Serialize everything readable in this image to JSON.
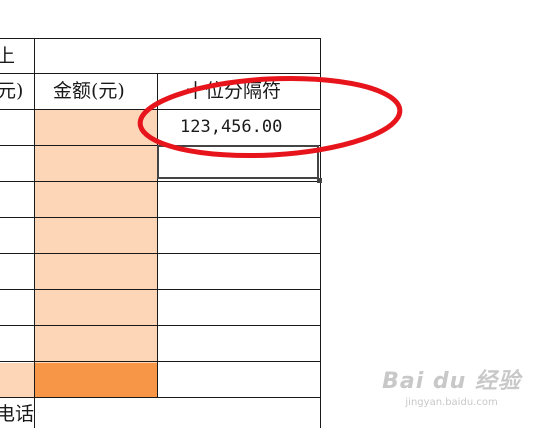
{
  "sheet": {
    "header_row_label": "上",
    "col_a_header_partial": "元)",
    "col_b_header": "金额(元)",
    "col_c_header": "十位分隔符",
    "sample_value": "123,456.00",
    "footer_label_partial": "电话"
  },
  "colors": {
    "peach_fill": "#fdd5b7",
    "orange_fill": "#f79646",
    "annotation_red": "#e8141b",
    "grid_line": "#1a1a1a"
  },
  "watermark": {
    "brand": "Bai du 经验",
    "url": "jingyan.baidu.com"
  }
}
